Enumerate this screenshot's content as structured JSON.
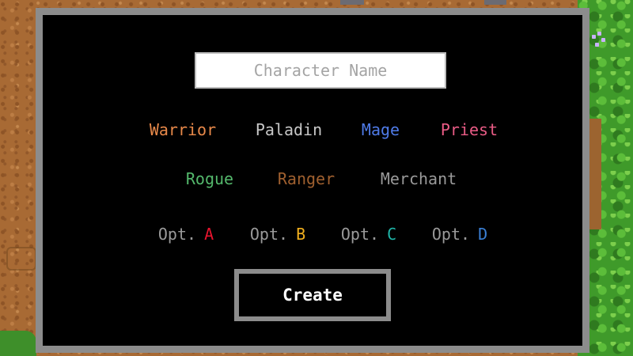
{
  "character_creation": {
    "name_input": {
      "placeholder": "Character Name",
      "value": ""
    },
    "classes_row1": [
      {
        "label": "Warrior",
        "color": "#e8894a"
      },
      {
        "label": "Paladin",
        "color": "#c8c8c8"
      },
      {
        "label": "Mage",
        "color": "#4f7be8"
      },
      {
        "label": "Priest",
        "color": "#ea5c86"
      }
    ],
    "classes_row2": [
      {
        "label": "Rogue",
        "color": "#54b86c"
      },
      {
        "label": "Ranger",
        "color": "#a0602f"
      },
      {
        "label": "Merchant",
        "color": "#9a9a9a"
      }
    ],
    "options": [
      {
        "prefix": "Opt.",
        "letter": "A",
        "color": "#e8142e"
      },
      {
        "prefix": "Opt.",
        "letter": "B",
        "color": "#f2b01e"
      },
      {
        "prefix": "Opt.",
        "letter": "C",
        "color": "#1fb5a8"
      },
      {
        "prefix": "Opt.",
        "letter": "D",
        "color": "#3a7fd4"
      }
    ],
    "create_button": {
      "label": "Create"
    }
  },
  "colors": {
    "dialog_background": "#000000",
    "dialog_border": "#8c8c8c",
    "dirt": "#a86a34",
    "grass": "#3f9a2a"
  }
}
